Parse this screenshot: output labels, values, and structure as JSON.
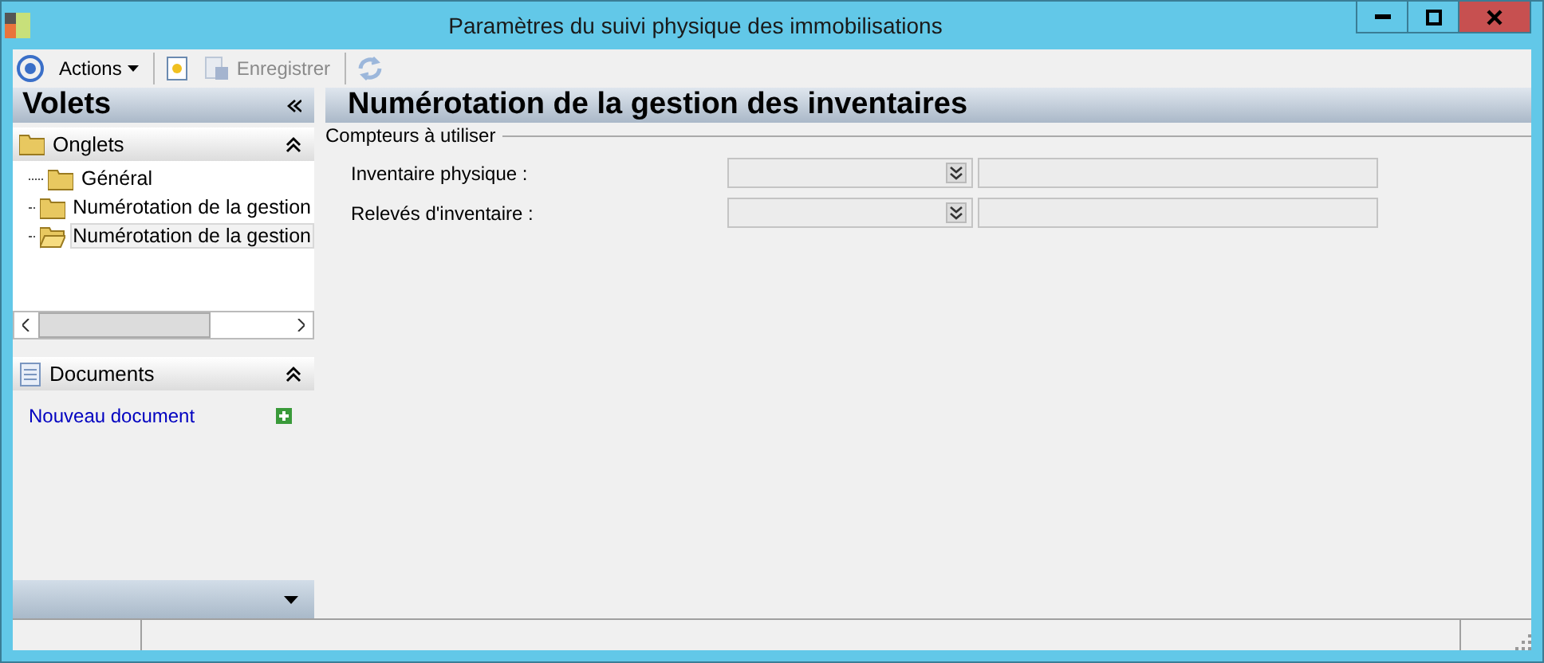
{
  "window": {
    "title": "Paramètres du suivi physique des immobilisations"
  },
  "toolbar": {
    "items": [
      {
        "kind": "menu",
        "label": "Actions",
        "disabled": false
      },
      {
        "kind": "icon",
        "disabled": false
      },
      {
        "kind": "button",
        "label": "Enregistrer",
        "disabled": true
      },
      {
        "kind": "refresh",
        "disabled": true
      }
    ]
  },
  "sidebar": {
    "title": "Volets",
    "tabs_panel": {
      "title": "Onglets",
      "expanded": true,
      "items": [
        {
          "label": "Général",
          "selected": false
        },
        {
          "label": "Numérotation de la gestion",
          "selected": false
        },
        {
          "label": "Numérotation de la gestion",
          "selected": true
        }
      ]
    },
    "documents_panel": {
      "title": "Documents",
      "expanded": true,
      "link": "Nouveau document"
    }
  },
  "content": {
    "title": "Numérotation de la gestion des inventaires",
    "group": {
      "title": "Compteurs à utiliser",
      "fields": [
        {
          "label": "Inventaire physique :"
        },
        {
          "label": "Relevés d'inventaire :"
        }
      ]
    }
  }
}
